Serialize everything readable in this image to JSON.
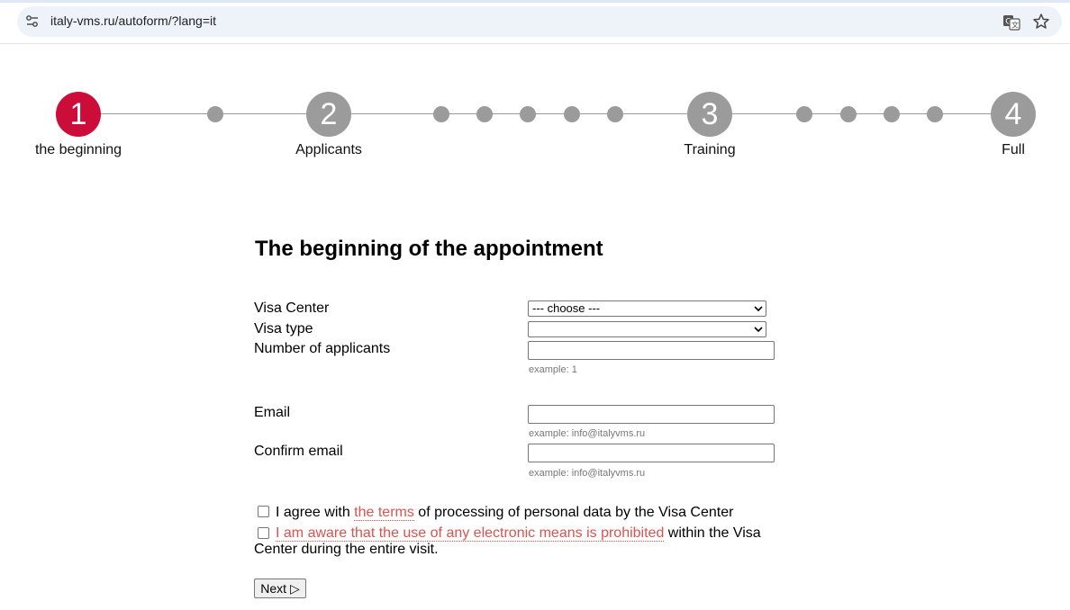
{
  "browser": {
    "url": "italy-vms.ru/autoform/?lang=it",
    "icons": [
      "site-info-icon",
      "translate-icon",
      "star-icon"
    ]
  },
  "stepper": {
    "steps": [
      {
        "number": "1",
        "label": "the beginning",
        "active": true
      },
      {
        "number": "2",
        "label": "Applicants",
        "active": false
      },
      {
        "number": "3",
        "label": "Training",
        "active": false
      },
      {
        "number": "4",
        "label": "Full",
        "active": false
      }
    ],
    "active_color": "#cc0c39",
    "inactive_color": "#9b9b9b"
  },
  "form": {
    "title": "The beginning of the appointment",
    "visa_center": {
      "label": "Visa Center",
      "selected": "--- choose ---"
    },
    "visa_type": {
      "label": "Visa type",
      "selected": ""
    },
    "applicants": {
      "label": "Number of applicants",
      "value": "",
      "hint_prefix": "example: ",
      "hint_value": "1"
    },
    "email": {
      "label": "Email",
      "value": "",
      "hint": "example: info@italyvms.ru"
    },
    "confirm_email": {
      "label": "Confirm email",
      "value": "",
      "hint": "example: info@italyvms.ru"
    },
    "agree_terms": {
      "before": "I agree with ",
      "link": "the terms",
      "after": " of processing of personal data by the Visa Center",
      "checked": false
    },
    "agree_electronic": {
      "link": " I am aware that the use of any electronic means is prohibited",
      "after": " within the Visa Center during the entire visit.",
      "checked": false
    },
    "next_label": "Next ▷"
  },
  "link_color": "#d9534f"
}
